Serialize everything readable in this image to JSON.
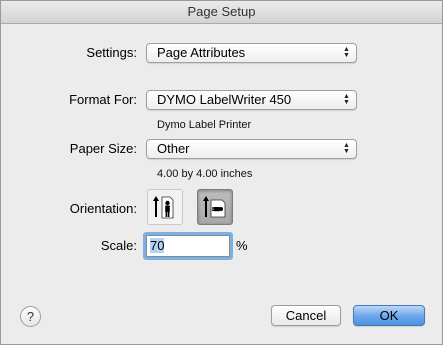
{
  "window": {
    "title": "Page Setup"
  },
  "settings": {
    "label": "Settings:",
    "value": "Page Attributes"
  },
  "format_for": {
    "label": "Format For:",
    "value": "DYMO LabelWriter 450",
    "description": "Dymo Label Printer"
  },
  "paper_size": {
    "label": "Paper Size:",
    "value": "Other",
    "description": "4.00 by 4.00 inches"
  },
  "orientation": {
    "label": "Orientation:",
    "options": [
      "portrait",
      "landscape"
    ],
    "selected": "landscape"
  },
  "scale": {
    "label": "Scale:",
    "value": "70",
    "unit": "%"
  },
  "buttons": {
    "help": "?",
    "cancel": "Cancel",
    "ok": "OK"
  },
  "colors": {
    "default_button": "#5a9ee6",
    "focus_ring": "#7ab0e8",
    "selected_orientation": "#b0b0b0"
  },
  "icons": {
    "popup_arrows": "up-down-arrows-icon",
    "portrait": "portrait-orientation-icon",
    "landscape": "landscape-orientation-icon"
  }
}
